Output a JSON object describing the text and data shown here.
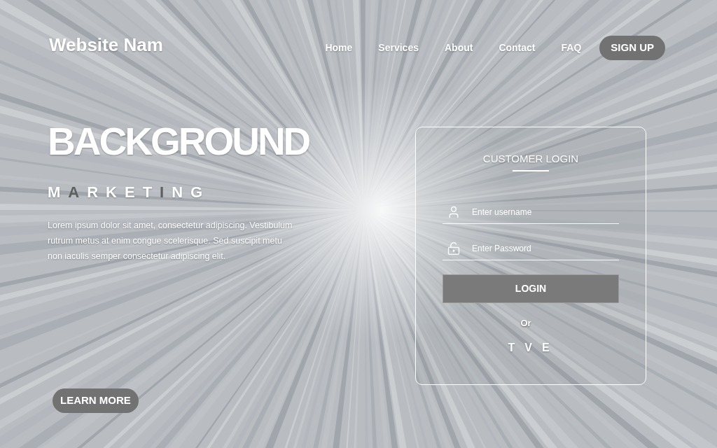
{
  "header": {
    "logo": "Website Nam",
    "nav": [
      {
        "label": "Home"
      },
      {
        "label": "Services"
      },
      {
        "label": "About"
      },
      {
        "label": "Contact"
      },
      {
        "label": "FAQ"
      }
    ],
    "signup_button": "SIGN UP"
  },
  "hero": {
    "title": "BACKGROUND",
    "tagline": [
      {
        "text": "M",
        "accent": false
      },
      {
        "text": "A",
        "accent": true
      },
      {
        "text": "RKET",
        "accent": false
      },
      {
        "text": "I",
        "accent": true
      },
      {
        "text": "NG",
        "accent": false
      }
    ],
    "body": "Lorem ipsum dolor sit amet, consectetur adipiscing. Vestibulum rutrum metus at enim congue scelerisque. Sed suscipit metu non iaculis semper consectetur adipiscing elit.",
    "button": "LEARN MORE"
  },
  "login": {
    "title": "CUSTOMER LOGIN",
    "fields": [
      {
        "kind": "username",
        "placeholder": "Enter username"
      },
      {
        "kind": "password",
        "placeholder": "Enter Password"
      }
    ],
    "button": "LOGIN",
    "divider": "Or",
    "social": [
      "T",
      "V",
      "E"
    ]
  }
}
